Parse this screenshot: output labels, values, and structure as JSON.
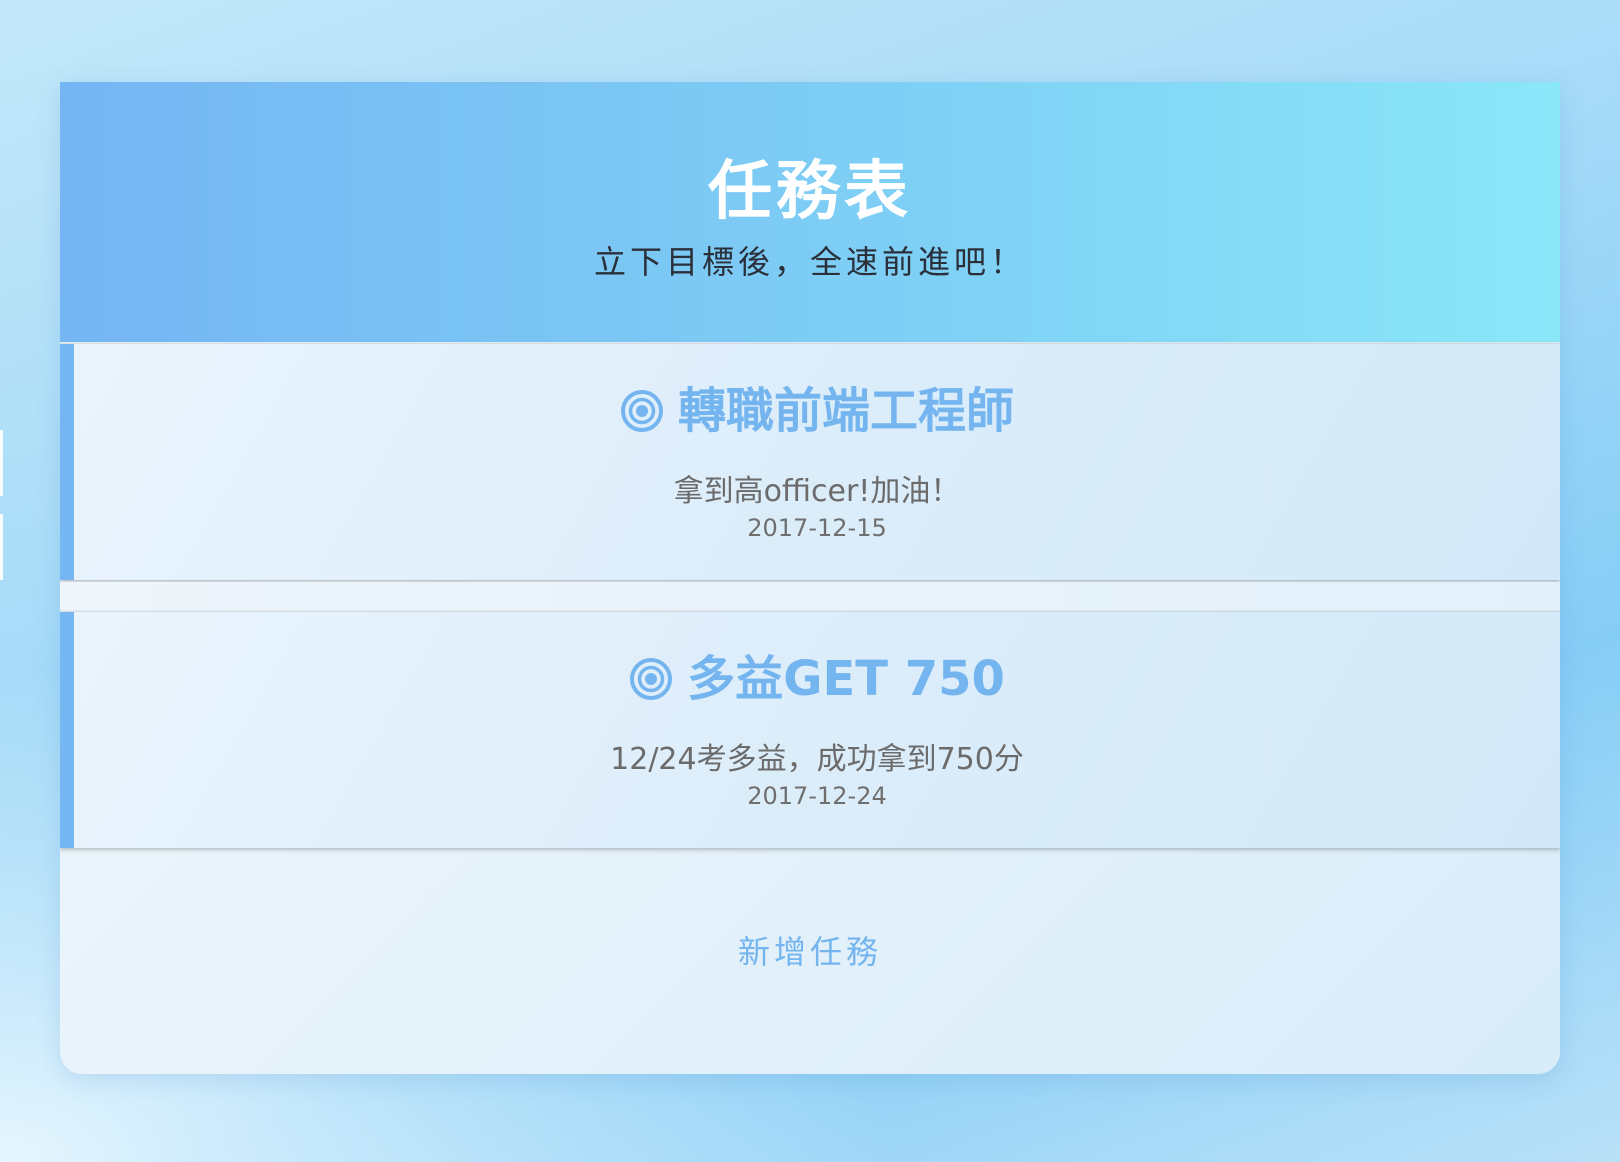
{
  "header": {
    "title": "任務表",
    "subtitle": "立下目標後，全速前進吧！"
  },
  "tasks": [
    {
      "icon": "target-icon",
      "title": "轉職前端工程師",
      "description": "拿到高officer!加油！",
      "date": "2017-12-15"
    },
    {
      "icon": "target-icon",
      "title": "多益GET 750",
      "description": "12/24考多益，成功拿到750分",
      "date": "2017-12-24"
    }
  ],
  "actions": {
    "add_task_label": "新增任務"
  },
  "colors": {
    "accent": "#74b5f0",
    "header_start": "#75b5f4",
    "header_end": "#8ae7f8",
    "title_text": "#ffffff",
    "body_text": "#6b6b6b"
  }
}
